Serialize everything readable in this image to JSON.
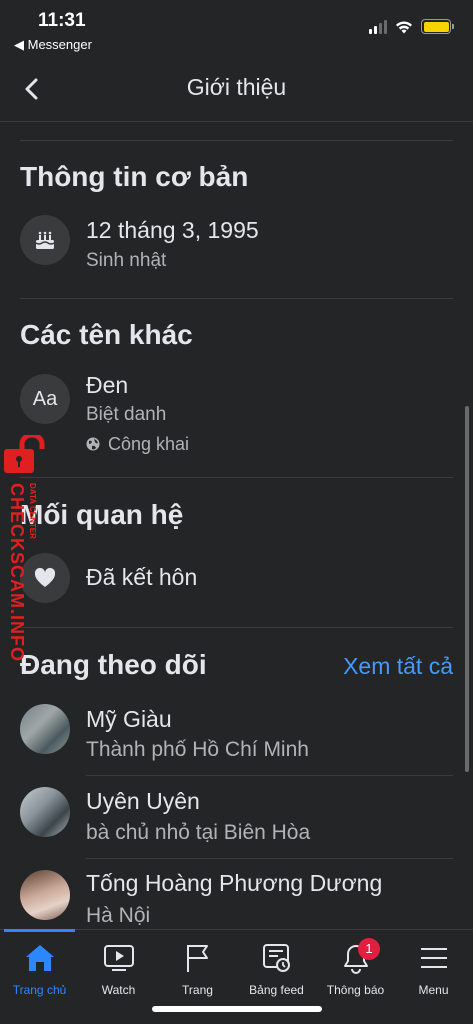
{
  "status_bar": {
    "time": "11:31",
    "back_app": "◀ Messenger",
    "battery_color": "#f5d400"
  },
  "header": {
    "title": "Giới thiệu"
  },
  "basic_info": {
    "title": "Thông tin cơ bản",
    "birthday_value": "12 tháng 3, 1995",
    "birthday_label": "Sinh nhật",
    "icon": "cake-icon"
  },
  "other_names": {
    "title": "Các tên khác",
    "icon_text": "Aa",
    "name": "Đen",
    "type": "Biệt danh",
    "privacy": "Công khai"
  },
  "relationship": {
    "title": "Mối quan hệ",
    "status": "Đã kết hôn",
    "icon": "heart-icon"
  },
  "following": {
    "title": "Đang theo dõi",
    "see_all": "Xem tất cả",
    "items": [
      {
        "name": "Mỹ Giàu",
        "detail": "Thành phố Hồ Chí Minh"
      },
      {
        "name": "Uyên Uyên",
        "detail": "bà chủ nhỏ tại Biên Hòa"
      },
      {
        "name": "Tống Hoàng Phương Dương",
        "detail": "Hà Nội"
      }
    ]
  },
  "watermark": {
    "main": "CHECKSCAM.INFO",
    "sub": "DATA CENTER"
  },
  "bottom_nav": {
    "items": [
      {
        "label": "Trang chủ",
        "icon": "home-icon",
        "active": true
      },
      {
        "label": "Watch",
        "icon": "video-icon"
      },
      {
        "label": "Trang",
        "icon": "flag-icon"
      },
      {
        "label": "Bảng feed",
        "icon": "feed-icon"
      },
      {
        "label": "Thông báo",
        "icon": "bell-icon",
        "badge": "1"
      },
      {
        "label": "Menu",
        "icon": "menu-icon"
      }
    ]
  },
  "colors": {
    "accent": "#2d88ff",
    "link": "#4599ff",
    "badge": "#e41e3f",
    "background": "#242526"
  }
}
